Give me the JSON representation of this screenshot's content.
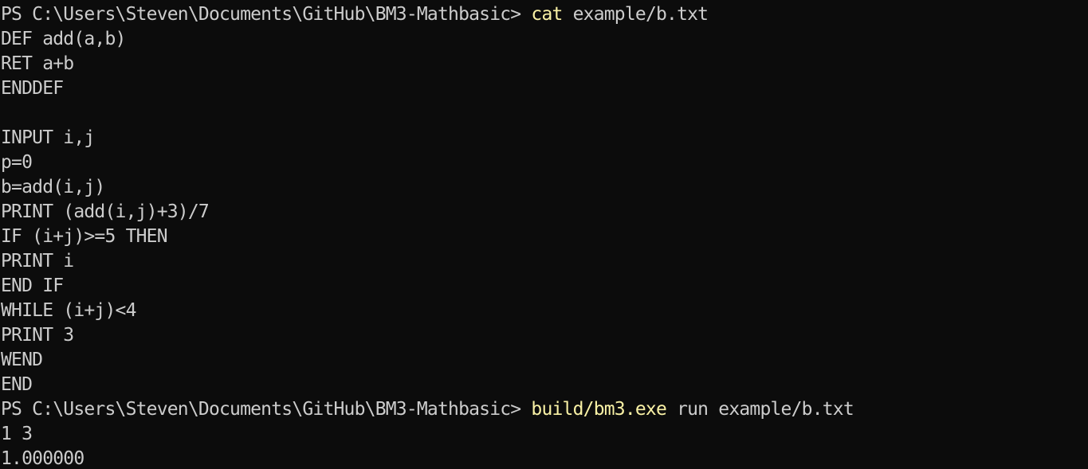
{
  "theme": {
    "background": "#0c0c0c",
    "foreground": "#cccccc",
    "command_color": "#f9f1a5"
  },
  "lines": [
    {
      "type": "prompt",
      "prompt": "PS C:\\Users\\Steven\\Documents\\GitHub\\BM3-Mathbasic> ",
      "cmd": "cat",
      "args": " example/b.txt"
    },
    {
      "type": "output",
      "text": "DEF add(a,b)"
    },
    {
      "type": "output",
      "text": "RET a+b"
    },
    {
      "type": "output",
      "text": "ENDDEF"
    },
    {
      "type": "output",
      "text": ""
    },
    {
      "type": "output",
      "text": "INPUT i,j"
    },
    {
      "type": "output",
      "text": "p=0"
    },
    {
      "type": "output",
      "text": "b=add(i,j)"
    },
    {
      "type": "output",
      "text": "PRINT (add(i,j)+3)/7"
    },
    {
      "type": "output",
      "text": "IF (i+j)>=5 THEN"
    },
    {
      "type": "output",
      "text": "PRINT i"
    },
    {
      "type": "output",
      "text": "END IF"
    },
    {
      "type": "output",
      "text": "WHILE (i+j)<4"
    },
    {
      "type": "output",
      "text": "PRINT 3"
    },
    {
      "type": "output",
      "text": "WEND"
    },
    {
      "type": "output",
      "text": "END"
    },
    {
      "type": "prompt",
      "prompt": "PS C:\\Users\\Steven\\Documents\\GitHub\\BM3-Mathbasic> ",
      "cmd": "build/bm3.exe",
      "args": " run example/b.txt"
    },
    {
      "type": "output",
      "text": "1 3"
    },
    {
      "type": "output",
      "text": "1.000000"
    }
  ]
}
